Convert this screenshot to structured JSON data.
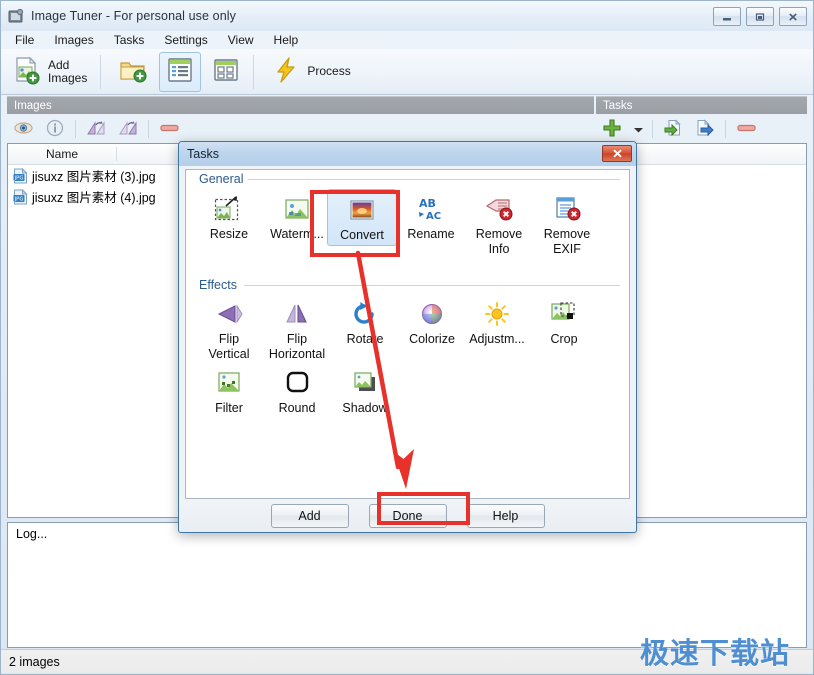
{
  "window": {
    "title": "Image Tuner - For personal use only",
    "icon": "app-icon",
    "controls": [
      {
        "name": "minimize",
        "glyph": "minimize-icon"
      },
      {
        "name": "maximize",
        "glyph": "maximize-icon"
      },
      {
        "name": "close",
        "glyph": "close-icon"
      }
    ]
  },
  "menu": {
    "items": [
      {
        "label": "File"
      },
      {
        "label": "Images"
      },
      {
        "label": "Tasks"
      },
      {
        "label": "Settings"
      },
      {
        "label": "View"
      },
      {
        "label": "Help"
      }
    ]
  },
  "toolbar": {
    "add_images_label": "Add\nImages",
    "add_folder_icon": "add-folder-icon",
    "list_view_icon": "details-view-icon",
    "thumb_view_icon": "thumbnail-view-icon",
    "process_label": "Process",
    "process_icon": "lightning-icon"
  },
  "images_panel": {
    "header": "Images",
    "toolbar_icons": [
      {
        "name": "preview-icon"
      },
      {
        "name": "info-icon"
      },
      {
        "name": "rotate-left-icon"
      },
      {
        "name": "rotate-right-icon"
      },
      {
        "name": "remove-icon"
      }
    ],
    "column_header": "Name",
    "rows": [
      {
        "icon": "jpg-file-icon",
        "name": "jisuxz 图片素材 (3).jpg"
      },
      {
        "icon": "jpg-file-icon",
        "name": "jisuxz 图片素材 (4).jpg"
      }
    ]
  },
  "tasks_panel": {
    "header": "Tasks",
    "toolbar_icons": [
      {
        "name": "add-task-icon"
      },
      {
        "name": "dropdown-arrow-icon"
      },
      {
        "name": "import-task-icon"
      },
      {
        "name": "export-task-icon"
      },
      {
        "name": "remove-task-icon"
      }
    ],
    "rows": []
  },
  "log": {
    "text": "Log..."
  },
  "statusbar": {
    "text": "2 images"
  },
  "watermark": {
    "text": "极速下载站"
  },
  "dialog": {
    "title": "Tasks",
    "close_glyph": "close-icon",
    "groups": [
      {
        "label": "General",
        "items": [
          {
            "label": "Resize",
            "icon": "resize-icon",
            "selected": false
          },
          {
            "label": "Waterm...",
            "icon": "watermark-icon",
            "selected": false
          },
          {
            "label": "Convert",
            "icon": "convert-icon",
            "selected": true
          },
          {
            "label": "Rename",
            "icon": "rename-icon",
            "selected": false
          },
          {
            "label": "Remove\nInfo",
            "icon": "remove-info-icon",
            "selected": false
          },
          {
            "label": "Remove\nEXIF",
            "icon": "remove-exif-icon",
            "selected": false
          }
        ]
      },
      {
        "label": "Effects",
        "items": [
          {
            "label": "Flip\nVertical",
            "icon": "flip-vertical-icon",
            "selected": false
          },
          {
            "label": "Flip\nHorizontal",
            "icon": "flip-horizontal-icon",
            "selected": false
          },
          {
            "label": "Rotate",
            "icon": "rotate-icon",
            "selected": false
          },
          {
            "label": "Colorize",
            "icon": "colorize-icon",
            "selected": false
          },
          {
            "label": "Adjustm...",
            "icon": "adjustments-icon",
            "selected": false
          },
          {
            "label": "Crop",
            "icon": "crop-icon",
            "selected": false
          },
          {
            "label": "Filter",
            "icon": "filter-icon",
            "selected": false
          },
          {
            "label": "Round",
            "icon": "round-corners-icon",
            "selected": false
          },
          {
            "label": "Shadow",
            "icon": "shadow-icon",
            "selected": false
          }
        ]
      }
    ],
    "buttons": [
      {
        "label": "Add",
        "name": "add-button"
      },
      {
        "label": "Done",
        "name": "done-button"
      },
      {
        "label": "Help",
        "name": "help-button"
      }
    ]
  },
  "annotations": {
    "color": "#e8312a",
    "highlight_convert": true,
    "highlight_add": true,
    "arrow": "convert-to-add-arrow"
  }
}
